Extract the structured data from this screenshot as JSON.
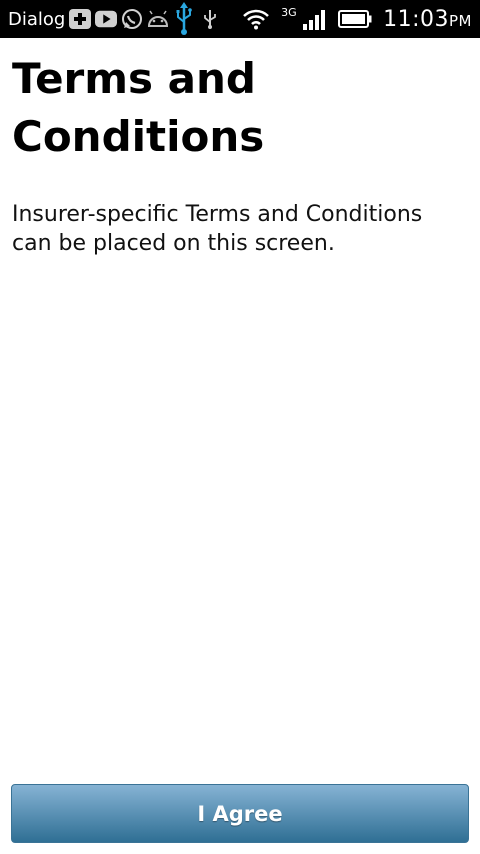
{
  "status_bar": {
    "carrier": "Dialog",
    "network_type": "3G",
    "time": "11:03",
    "ampm": "PM",
    "icons": [
      "plus-icon",
      "youtube-icon",
      "whatsapp-icon",
      "android-icon",
      "usb-icon",
      "usb-debug-icon",
      "wifi-icon",
      "signal-icon",
      "battery-icon"
    ]
  },
  "page": {
    "title_line1": "Terms and",
    "title_line2": "Conditions",
    "body": "Insurer-specific Terms and Conditions can be placed on this screen."
  },
  "footer": {
    "agree_label": "I Agree"
  },
  "colors": {
    "button_top": "#86b3d4",
    "button_bottom": "#2f6f94",
    "usb_accent": "#2aa7e0"
  }
}
